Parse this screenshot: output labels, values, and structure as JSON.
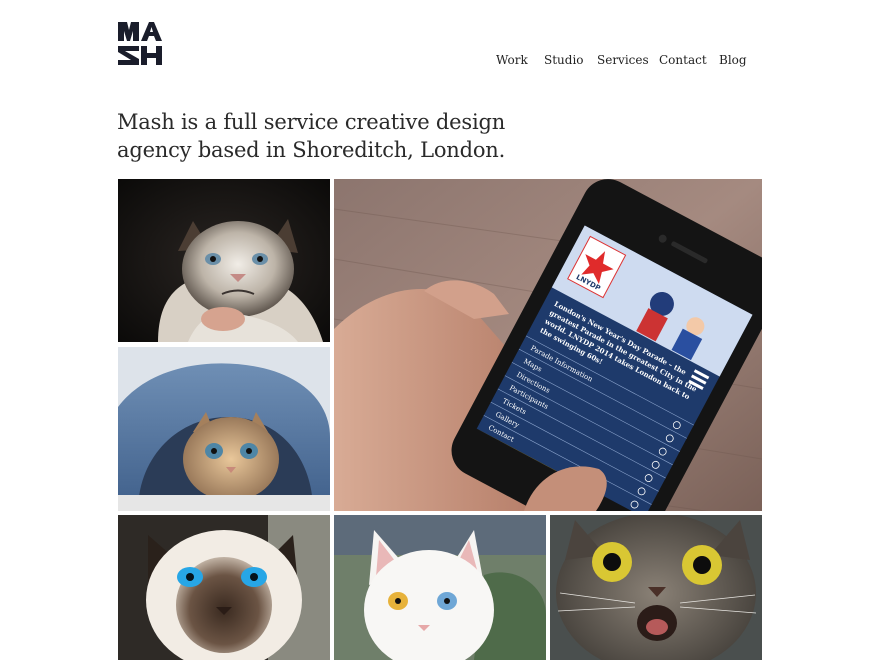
{
  "brand": {
    "name": "Mash",
    "logo_icon": "mash-logo-icon"
  },
  "nav": {
    "items": [
      {
        "label": "Work"
      },
      {
        "label": "Studio"
      },
      {
        "label": "Services"
      },
      {
        "label": "Contact"
      },
      {
        "label": "Blog"
      }
    ]
  },
  "hero": {
    "line1": "Mash is a full service creative design",
    "line2": "agency based in Shoreditch, London."
  },
  "portfolio": {
    "phone": {
      "app_logo": "LNYDP",
      "blurb": "London's New Year's Day Parade – the greatest Parade in the greatest City in the world. LNYDP 2014 takes London back to the swinging 60s!",
      "menu": [
        "Parade Information",
        "Maps",
        "Directions",
        "Participants",
        "Tickets",
        "Gallery",
        "Contact"
      ]
    }
  }
}
